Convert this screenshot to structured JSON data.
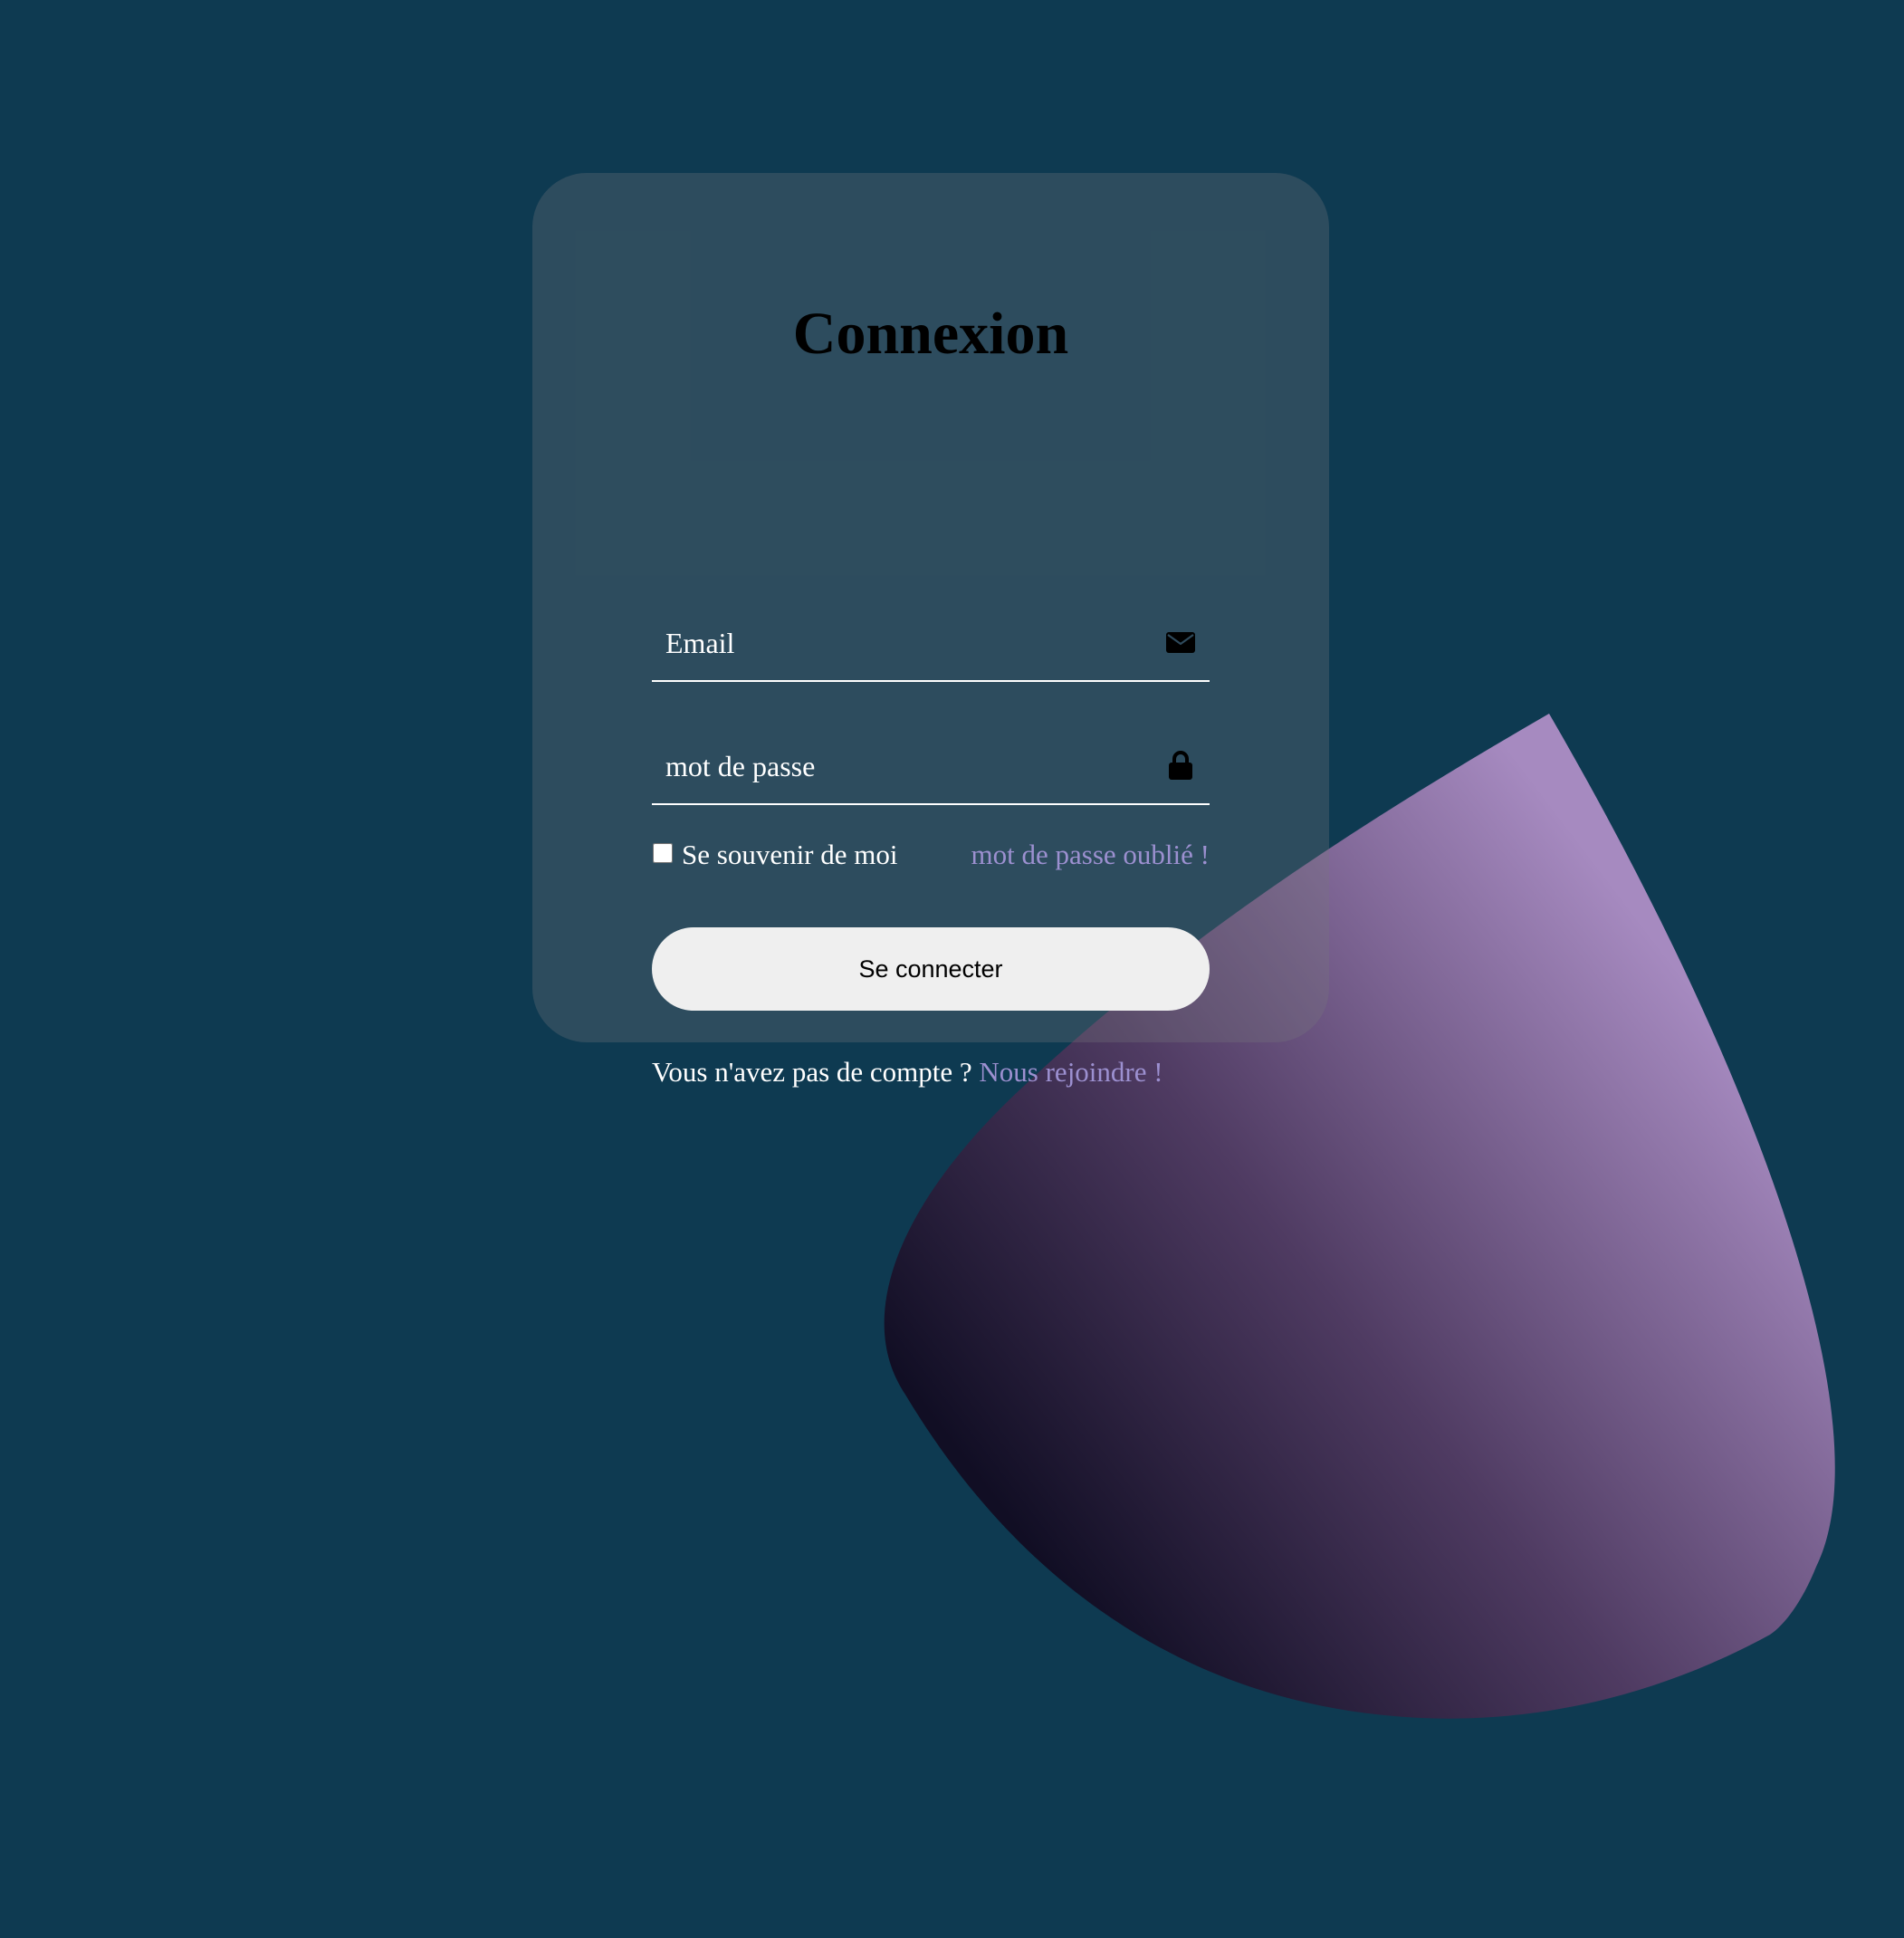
{
  "background": {
    "color": "#0e3a51"
  },
  "login": {
    "title": "Connexion",
    "email": {
      "placeholder": "Email",
      "icon": "envelope-icon"
    },
    "password": {
      "placeholder": "mot de passe",
      "icon": "lock-icon"
    },
    "remember_label": "Se souvenir de moi",
    "remember_checked": false,
    "forgot_label": "mot de passe oublié !",
    "submit_label": "Se connecter",
    "register_prompt": "Vous n'avez pas de compte ?",
    "register_link": "Nous rejoindre !"
  },
  "colors": {
    "link": "#9c90d0",
    "button_bg": "#efefef",
    "blob_light": "#a68ac0",
    "blob_dark": "#110e24"
  }
}
